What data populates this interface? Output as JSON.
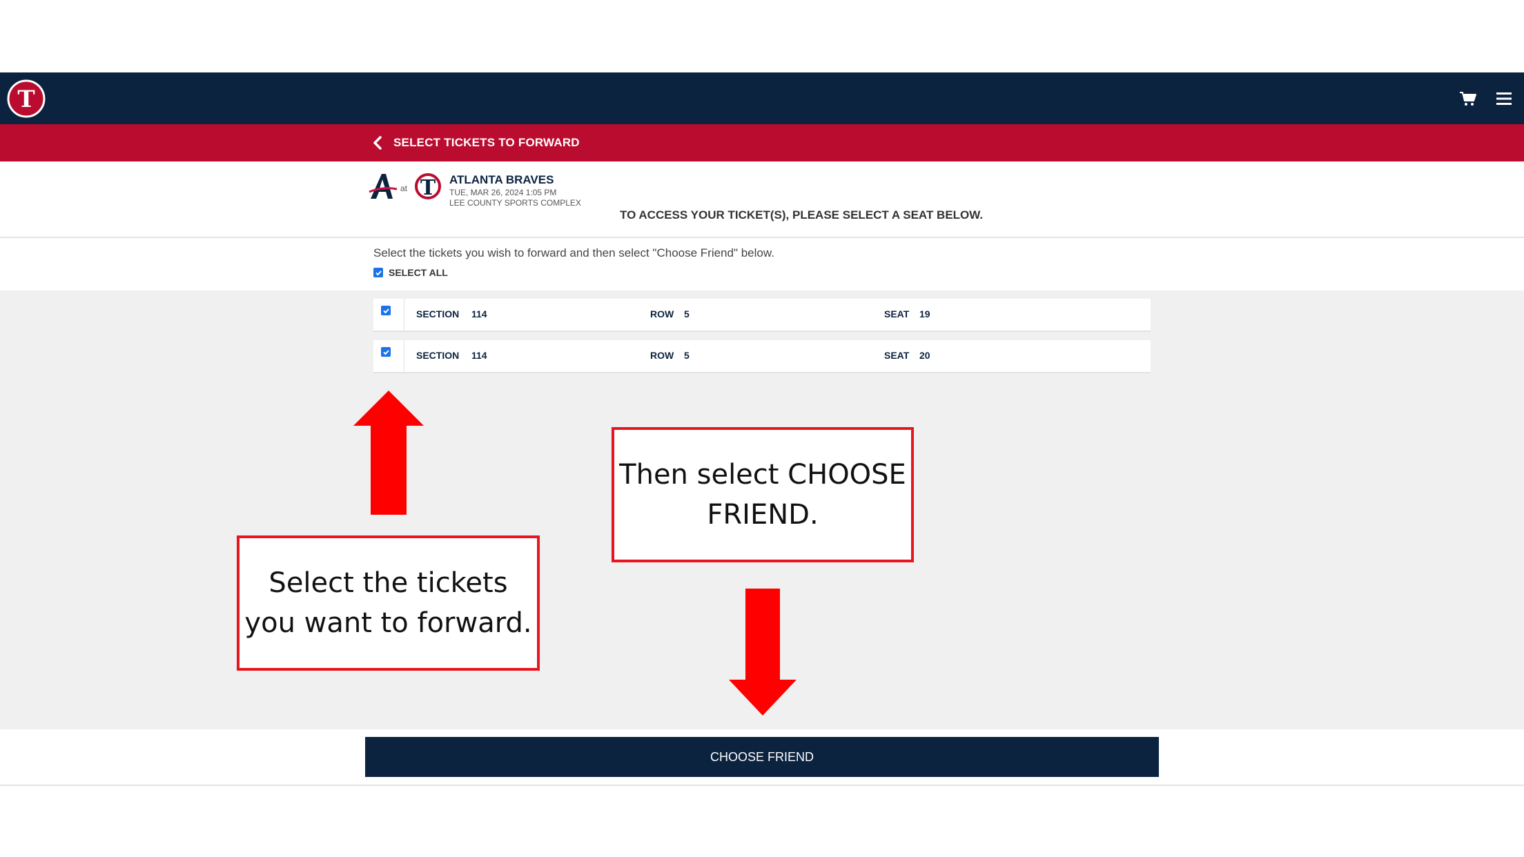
{
  "header": {
    "logo_icon": "twins-logo-icon",
    "cart_icon": "cart-icon",
    "menu_icon": "hamburger-menu-icon",
    "bg_color": "#0c2340"
  },
  "subheader": {
    "title": "SELECT TICKETS TO FORWARD",
    "back_icon": "chevron-left-icon",
    "bg_color": "#ba0c2f"
  },
  "event": {
    "at_label": "at",
    "team": "ATLANTA BRAVES",
    "datetime": "TUE, MAR 26, 2024 1:05 PM",
    "venue": "LEE COUNTY SPORTS COMPLEX",
    "access_message": "TO ACCESS YOUR TICKET(S), PLEASE SELECT A SEAT BELOW."
  },
  "instructions": {
    "text": "Select the tickets you wish to forward and then select \"Choose Friend\" below.",
    "select_all_label": "SELECT ALL",
    "select_all_checked": true
  },
  "tickets": [
    {
      "section_label": "SECTION",
      "section": "114",
      "row_label": "ROW",
      "row": "5",
      "seat_label": "SEAT",
      "seat": "19",
      "checked": true
    },
    {
      "section_label": "SECTION",
      "section": "114",
      "row_label": "ROW",
      "row": "5",
      "seat_label": "SEAT",
      "seat": "20",
      "checked": true
    }
  ],
  "annotations": {
    "left_callout": "Select the tickets you want to forward.",
    "right_callout": "Then select CHOOSE FRIEND.",
    "arrow_color": "#ff0000"
  },
  "footer": {
    "choose_friend_label": "CHOOSE FRIEND"
  }
}
